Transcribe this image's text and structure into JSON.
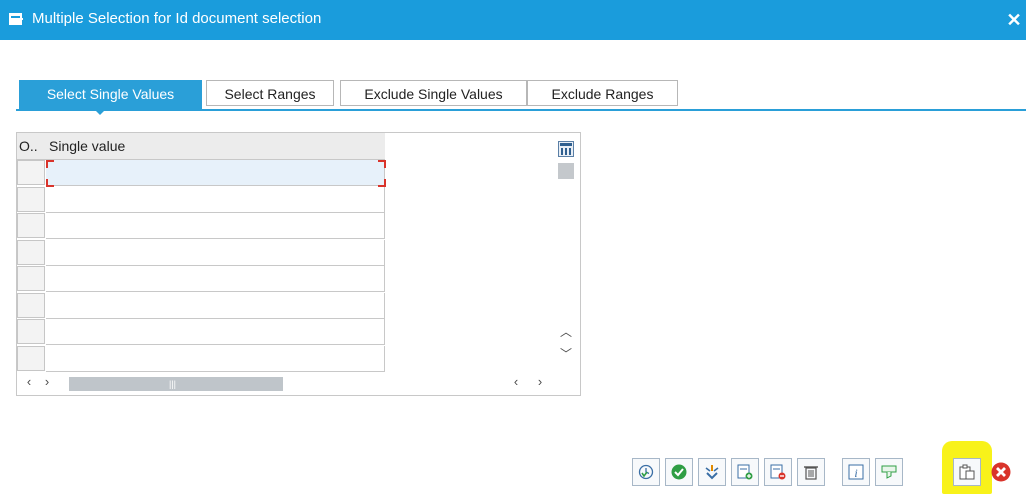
{
  "window": {
    "title": "Multiple Selection for Id document selection",
    "colors": {
      "titlebar": "#1a9cdc",
      "tab_active": "#2a9fd8",
      "highlight": "#f8f21a"
    }
  },
  "tabs": [
    {
      "label": "Select Single Values",
      "active": true
    },
    {
      "label": "Select Ranges",
      "active": false
    },
    {
      "label": "Exclude Single Values",
      "active": false
    },
    {
      "label": "Exclude Ranges",
      "active": false
    }
  ],
  "table": {
    "columns": [
      "O..",
      "Single value"
    ],
    "rows": [
      {
        "option": "",
        "value": ""
      },
      {
        "option": "",
        "value": ""
      },
      {
        "option": "",
        "value": ""
      },
      {
        "option": "",
        "value": ""
      },
      {
        "option": "",
        "value": ""
      },
      {
        "option": "",
        "value": ""
      },
      {
        "option": "",
        "value": ""
      },
      {
        "option": "",
        "value": ""
      }
    ]
  },
  "toolbar": {
    "buttons": [
      {
        "name": "execute-check-button",
        "icon": "clock-arrow-icon"
      },
      {
        "name": "copy-button",
        "icon": "green-check-icon"
      },
      {
        "name": "import-button",
        "icon": "arrow-merge-icon"
      },
      {
        "name": "insert-line-button",
        "icon": "insert-row-icon"
      },
      {
        "name": "delete-line-button",
        "icon": "delete-row-icon"
      },
      {
        "name": "delete-all-button",
        "icon": "trash-icon"
      },
      {
        "name": "help-button",
        "icon": "info-icon"
      },
      {
        "name": "filter-button",
        "icon": "filter-icon"
      },
      {
        "name": "paste-clipboard-button",
        "icon": "clipboard-paste-icon"
      },
      {
        "name": "cancel-button",
        "icon": "red-x-icon"
      }
    ]
  }
}
